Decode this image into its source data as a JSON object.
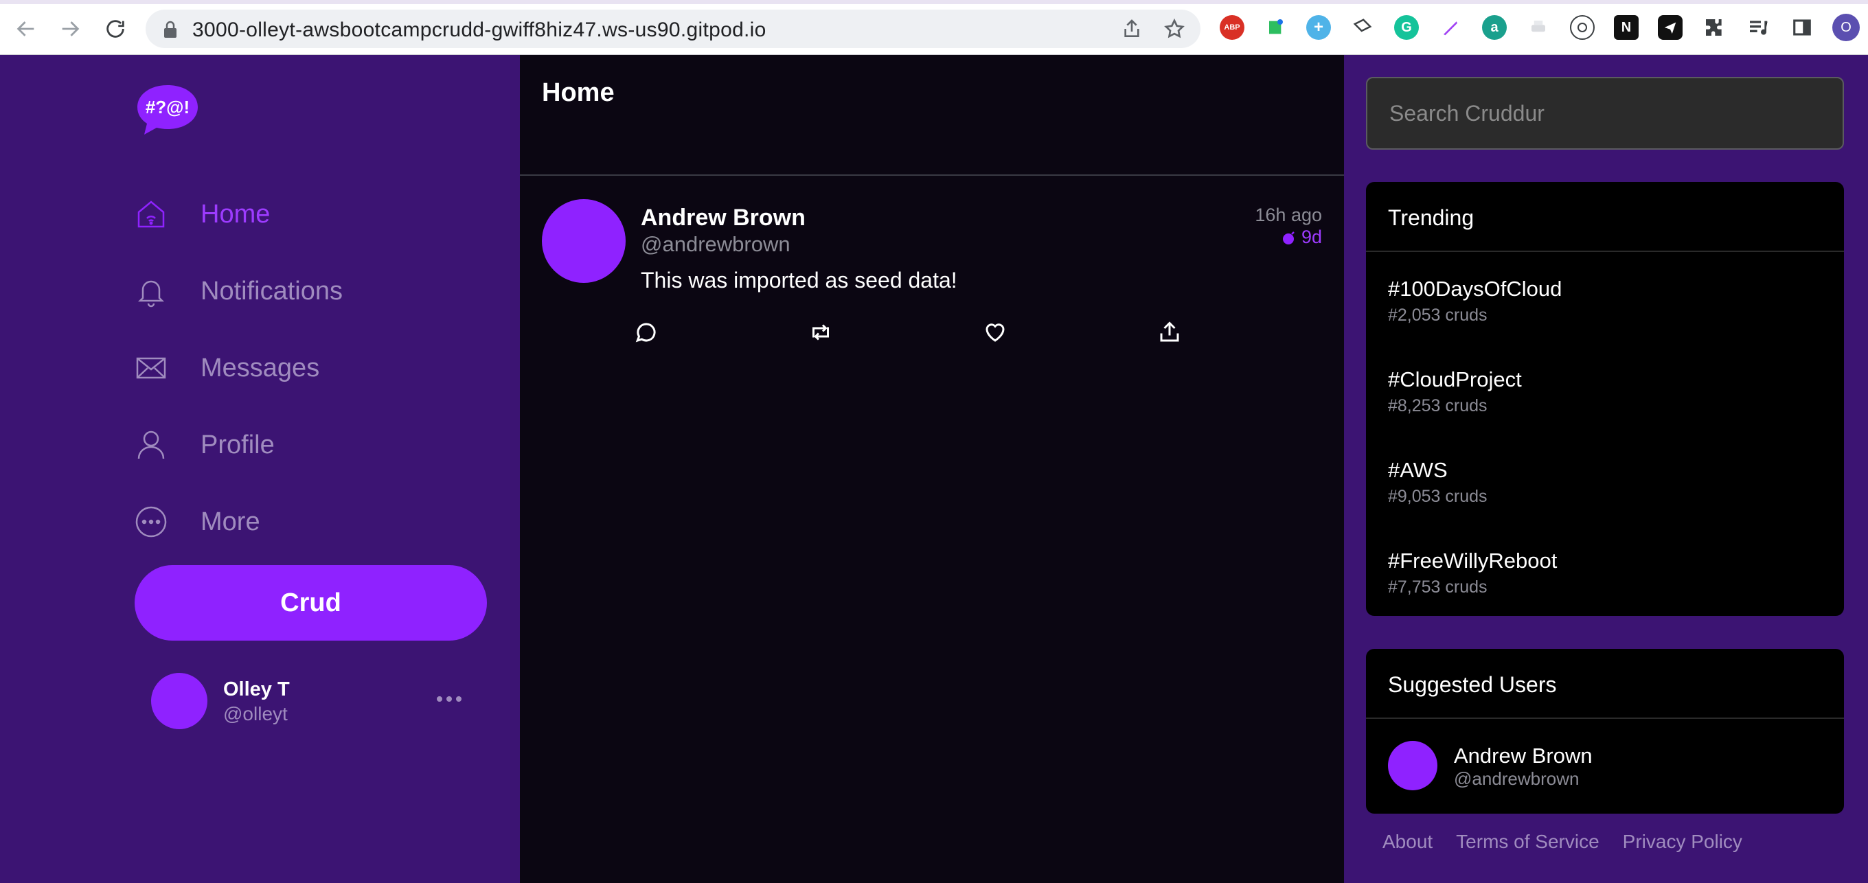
{
  "browser": {
    "url": "3000-olleyt-awsbootcampcrudd-gwiff8hiz47.ws-us90.gitpod.io",
    "profile_initial": "O",
    "extensions": [
      "ABP",
      "",
      "",
      "",
      "",
      "",
      "a",
      "",
      "",
      "N",
      "",
      "",
      "",
      ""
    ]
  },
  "sidebar": {
    "logo_text": "#?@!",
    "nav": [
      {
        "label": "Home",
        "icon": "home-icon"
      },
      {
        "label": "Notifications",
        "icon": "bell-icon"
      },
      {
        "label": "Messages",
        "icon": "envelope-icon"
      },
      {
        "label": "Profile",
        "icon": "person-icon"
      },
      {
        "label": "More",
        "icon": "more-circle-icon"
      }
    ],
    "crud_button_label": "Crud",
    "current_user": {
      "name": "Olley T",
      "handle": "@olleyt"
    }
  },
  "main": {
    "title": "Home",
    "posts": [
      {
        "display_name": "Andrew Brown",
        "handle": "@andrewbrown",
        "message": "This was imported as seed data!",
        "created": "16h ago",
        "expires": "9d"
      }
    ]
  },
  "rail": {
    "search_placeholder": "Search Cruddur",
    "trending_title": "Trending",
    "trending": [
      {
        "tag": "#100DaysOfCloud",
        "count": "#2,053 cruds"
      },
      {
        "tag": "#CloudProject",
        "count": "#8,253 cruds"
      },
      {
        "tag": "#AWS",
        "count": "#9,053 cruds"
      },
      {
        "tag": "#FreeWillyReboot",
        "count": "#7,753 cruds"
      }
    ],
    "suggested_title": "Suggested Users",
    "suggested": [
      {
        "name": "Andrew Brown",
        "handle": "@andrewbrown"
      }
    ],
    "footer": [
      "About",
      "Terms of Service",
      "Privacy Policy"
    ]
  },
  "colors": {
    "sidebar_bg": "#3c1473",
    "accent": "#8f22ff",
    "feed_bg": "#0b0612"
  }
}
